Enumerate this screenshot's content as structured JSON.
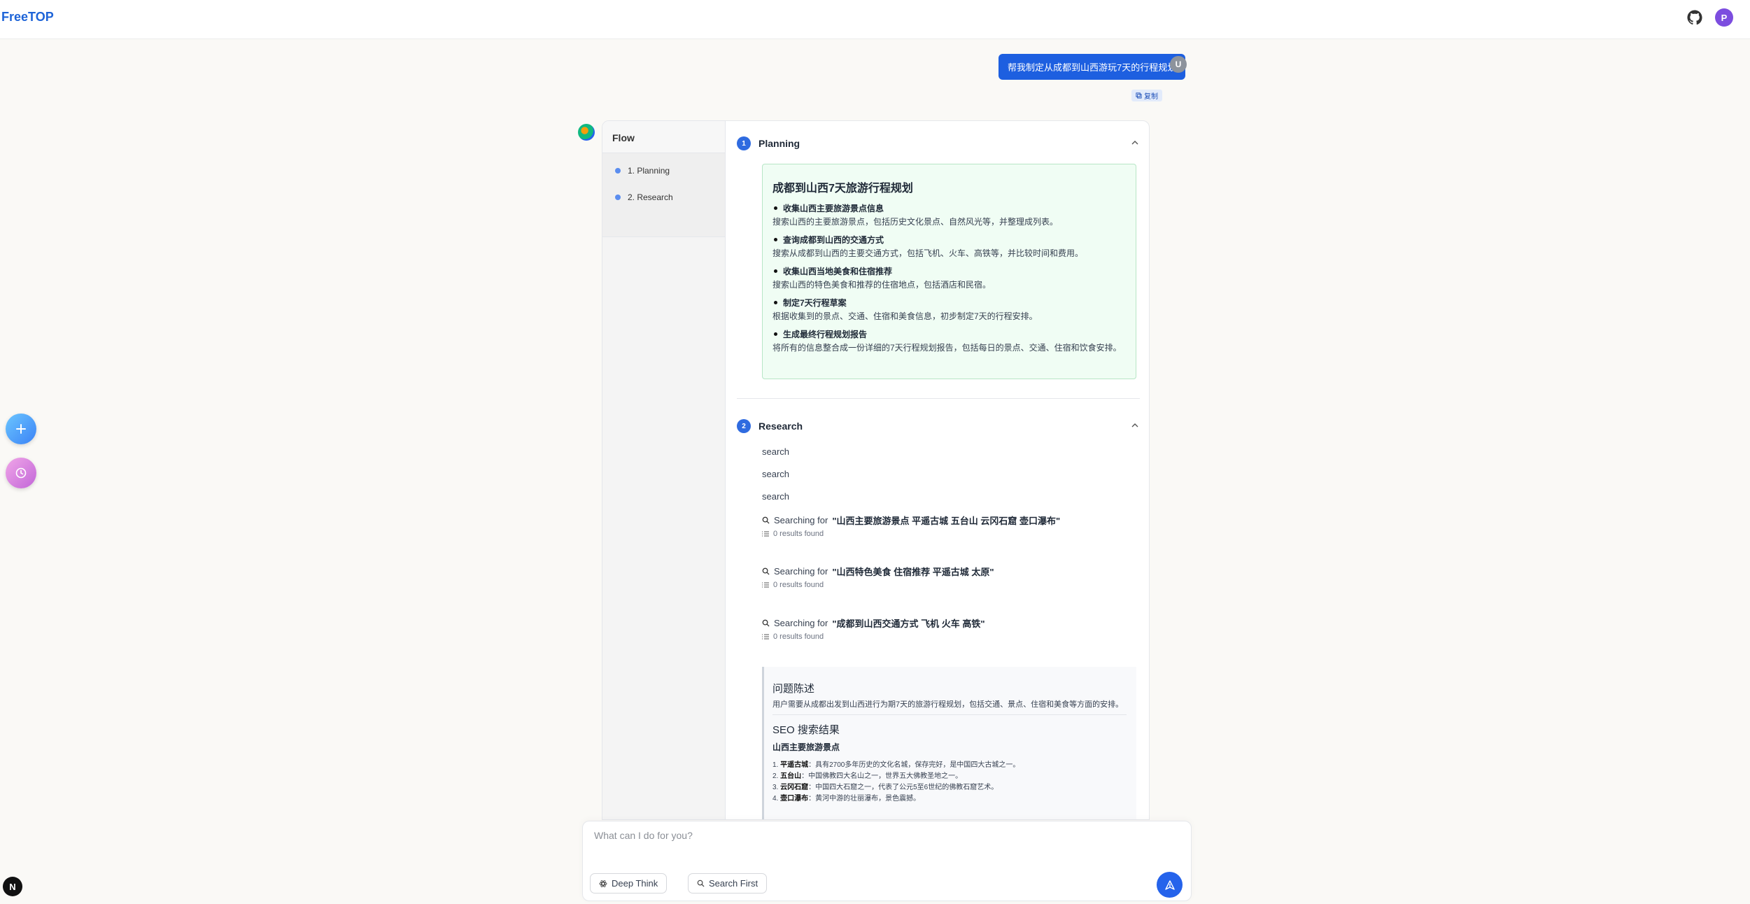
{
  "header": {
    "brand": "FreeTOP",
    "github_icon": "github-icon",
    "user_initial": "P"
  },
  "chat": {
    "user_message": "帮我制定从成都到山西游玩7天的行程规划",
    "user_initial": "U",
    "copy_label": "复制"
  },
  "flow": {
    "title": "Flow",
    "items": [
      {
        "label": "1. Planning"
      },
      {
        "label": "2. Research"
      }
    ]
  },
  "planning": {
    "number": "1",
    "title": "Planning",
    "box_title": "成都到山西7天旅游行程规划",
    "steps": [
      {
        "title": "收集山西主要旅游景点信息",
        "desc": "搜索山西的主要旅游景点，包括历史文化景点、自然风光等，并整理成列表。"
      },
      {
        "title": "查询成都到山西的交通方式",
        "desc": "搜索从成都到山西的主要交通方式，包括飞机、火车、高铁等，并比较时间和费用。"
      },
      {
        "title": "收集山西当地美食和住宿推荐",
        "desc": "搜索山西的特色美食和推荐的住宿地点，包括酒店和民宿。"
      },
      {
        "title": "制定7天行程草案",
        "desc": "根据收集到的景点、交通、住宿和美食信息，初步制定7天的行程安排。"
      },
      {
        "title": "生成最终行程规划报告",
        "desc": "将所有的信息整合成一份详细的7天行程规划报告，包括每日的景点、交通、住宿和饮食安排。"
      }
    ]
  },
  "research": {
    "number": "2",
    "title": "Research",
    "tool_calls": [
      "search",
      "search",
      "search"
    ],
    "searching_prefix": "Searching for",
    "searches": [
      {
        "query": "\"山西主要旅游景点 平遥古城 五台山 云冈石窟 壶口瀑布\"",
        "results": "0 results found"
      },
      {
        "query": "\"山西特色美食 住宿推荐 平遥古城 太原\"",
        "results": "0 results found"
      },
      {
        "query": "\"成都到山西交通方式 飞机 火车 高铁\"",
        "results": "0 results found"
      }
    ],
    "report": {
      "h1": "问题陈述",
      "p1": "用户需要从成都出发到山西进行为期7天的旅游行程规划，包括交通、景点、住宿和美食等方面的安排。",
      "h2": "SEO 搜索结果",
      "sub": "山西主要旅游景点",
      "items": [
        {
          "n": "1.",
          "name": "平遥古城",
          "desc": "：具有2700多年历史的文化名城，保存完好，是中国四大古城之一。"
        },
        {
          "n": "2.",
          "name": "五台山",
          "desc": "：中国佛教四大名山之一，世界五大佛教圣地之一。"
        },
        {
          "n": "3.",
          "name": "云冈石窟",
          "desc": "：中国四大石窟之一，代表了公元5至6世纪的佛教石窟艺术。"
        },
        {
          "n": "4.",
          "name": "壶口瀑布",
          "desc": "：黄河中游的壮丽瀑布，景色震撼。"
        }
      ]
    }
  },
  "input": {
    "placeholder": "What can I do for you?",
    "deep_think_label": "Deep Think",
    "search_first_label": "Search First"
  },
  "colors": {
    "accent": "#2563eb",
    "brand": "#1e64d8",
    "plan_bg": "#f0fdf4"
  }
}
